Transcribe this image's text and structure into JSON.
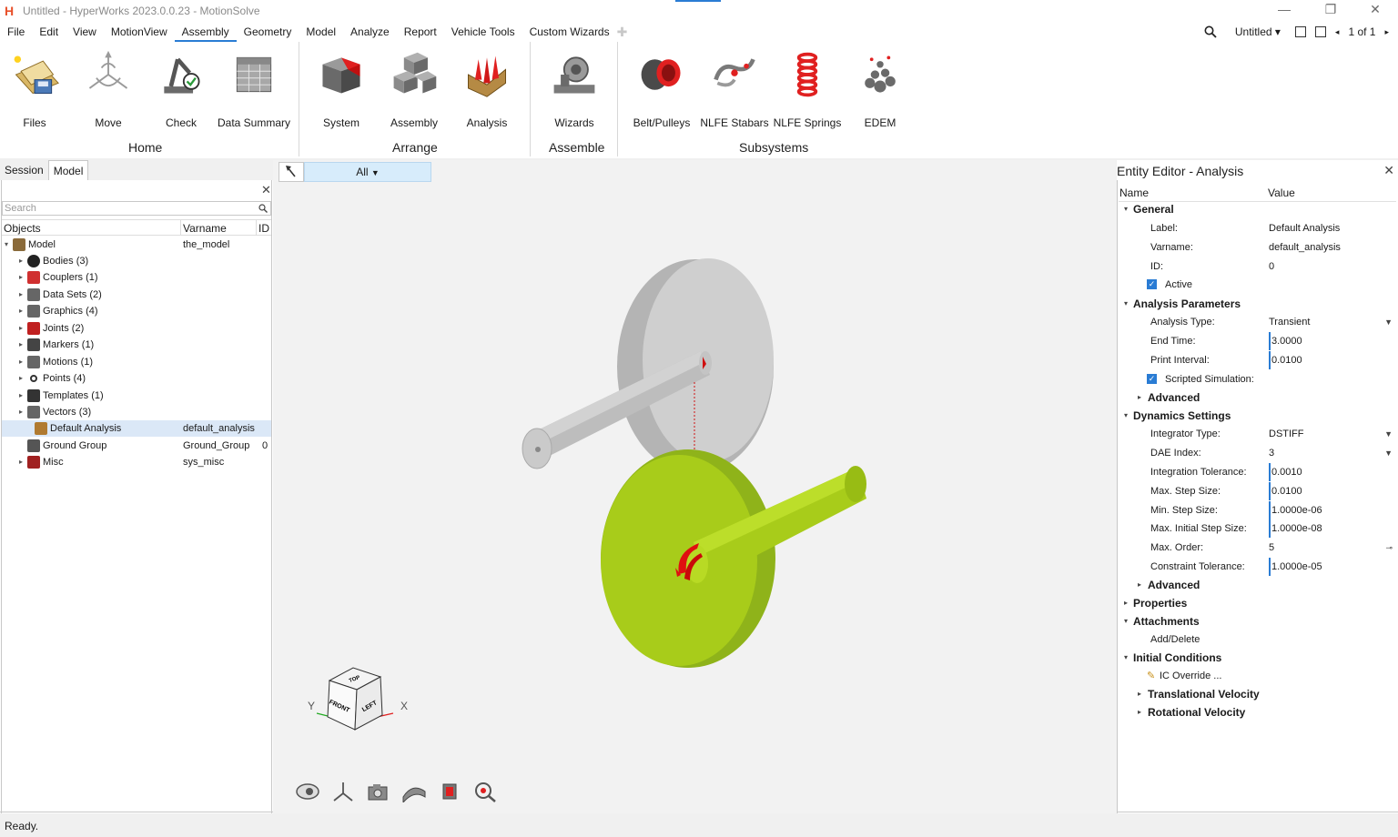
{
  "window": {
    "title": "Untitled - HyperWorks 2023.0.0.23 - MotionSolve",
    "logo": "H"
  },
  "menu": {
    "items": [
      "File",
      "Edit",
      "View",
      "MotionView",
      "Assembly",
      "Geometry",
      "Model",
      "Analyze",
      "Report",
      "Vehicle Tools",
      "Custom Wizards"
    ],
    "active": "Assembly",
    "session_name": "Untitled",
    "page_indicator": "1 of 1"
  },
  "ribbon": {
    "tools": [
      {
        "label": "Files",
        "icon": "files-icon"
      },
      {
        "label": "Move",
        "icon": "move-icon"
      },
      {
        "label": "Check",
        "icon": "check-icon"
      },
      {
        "label": "Data Summary",
        "icon": "data-summary-icon"
      },
      {
        "label": "System",
        "icon": "system-icon"
      },
      {
        "label": "Assembly",
        "icon": "assembly-icon"
      },
      {
        "label": "Analysis",
        "icon": "analysis-icon"
      },
      {
        "label": "Wizards",
        "icon": "wizards-icon"
      },
      {
        "label": "Belt/Pulleys",
        "icon": "belt-pulleys-icon"
      },
      {
        "label": "NLFE Stabars",
        "icon": "nlfe-stabars-icon"
      },
      {
        "label": "NLFE Springs",
        "icon": "nlfe-springs-icon"
      },
      {
        "label": "EDEM",
        "icon": "edem-icon"
      }
    ],
    "groups": [
      "Home",
      "Arrange",
      "Assemble",
      "Subsystems"
    ]
  },
  "browser": {
    "tabs": [
      "Session",
      "Model"
    ],
    "active_tab": "Model",
    "search_placeholder": "Search",
    "columns": [
      "Objects",
      "Varname",
      "ID"
    ],
    "rows": [
      {
        "label": "Model",
        "varname": "the_model",
        "id": "",
        "icon": "model-icon"
      },
      {
        "label": "Bodies (3)",
        "varname": "",
        "id": "",
        "icon": "bodies-icon"
      },
      {
        "label": "Couplers (1)",
        "varname": "",
        "id": "",
        "icon": "couplers-icon"
      },
      {
        "label": "Data Sets (2)",
        "varname": "",
        "id": "",
        "icon": "datasets-icon"
      },
      {
        "label": "Graphics (4)",
        "varname": "",
        "id": "",
        "icon": "graphics-icon"
      },
      {
        "label": "Joints (2)",
        "varname": "",
        "id": "",
        "icon": "joints-icon"
      },
      {
        "label": "Markers (1)",
        "varname": "",
        "id": "",
        "icon": "markers-icon"
      },
      {
        "label": "Motions (1)",
        "varname": "",
        "id": "",
        "icon": "motions-icon"
      },
      {
        "label": "Points (4)",
        "varname": "",
        "id": "",
        "icon": "points-icon"
      },
      {
        "label": "Templates (1)",
        "varname": "",
        "id": "",
        "icon": "templates-icon"
      },
      {
        "label": "Vectors (3)",
        "varname": "",
        "id": "",
        "icon": "vectors-icon"
      },
      {
        "label": "Default Analysis",
        "varname": "default_analysis",
        "id": "",
        "icon": "analysis-icon"
      },
      {
        "label": "Ground Group",
        "varname": "Ground_Group",
        "id": "0",
        "icon": "ground-icon"
      },
      {
        "label": "Misc",
        "varname": "sys_misc",
        "id": "",
        "icon": "misc-icon"
      }
    ]
  },
  "viewport": {
    "filter_label": "All",
    "axis_x": "X",
    "axis_y": "Y",
    "cube_faces": [
      "TOP",
      "FRONT",
      "LEFT"
    ],
    "colors": {
      "upper_disk": "#c8c8c8",
      "lower_disk": "#a8cc1a",
      "joint": "#e01010"
    }
  },
  "entity_editor": {
    "title": "Entity Editor - Analysis",
    "columns": [
      "Name",
      "Value"
    ],
    "rows": [
      {
        "name": "General",
        "value": "",
        "type": "section"
      },
      {
        "name": "Label:",
        "value": "Default Analysis",
        "type": "field"
      },
      {
        "name": "Varname:",
        "value": "default_analysis",
        "type": "field"
      },
      {
        "name": "ID:",
        "value": "0",
        "type": "field"
      },
      {
        "name": "Active",
        "value": "",
        "type": "check"
      },
      {
        "name": "Analysis Parameters",
        "value": "",
        "type": "section"
      },
      {
        "name": "Analysis Type:",
        "value": "Transient",
        "type": "dropdown"
      },
      {
        "name": "End Time:",
        "value": "3.0000",
        "type": "edit"
      },
      {
        "name": "Print Interval:",
        "value": "0.0100",
        "type": "edit"
      },
      {
        "name": "Scripted Simulation:",
        "value": "",
        "type": "check"
      },
      {
        "name": "Advanced",
        "value": "",
        "type": "subsection"
      },
      {
        "name": "Dynamics Settings",
        "value": "",
        "type": "section"
      },
      {
        "name": "Integrator Type:",
        "value": "DSTIFF",
        "type": "dropdown"
      },
      {
        "name": "DAE Index:",
        "value": "3",
        "type": "dropdown"
      },
      {
        "name": "Integration Tolerance:",
        "value": "0.0010",
        "type": "edit"
      },
      {
        "name": "Max. Step Size:",
        "value": "0.0100",
        "type": "edit"
      },
      {
        "name": "Min. Step Size:",
        "value": "1.0000e-06",
        "type": "edit"
      },
      {
        "name": "Max. Initial Step Size:",
        "value": "1.0000e-08",
        "type": "edit"
      },
      {
        "name": "Max. Order:",
        "value": "5",
        "type": "slider"
      },
      {
        "name": "Constraint Tolerance:",
        "value": "1.0000e-05",
        "type": "edit"
      },
      {
        "name": "Advanced",
        "value": "",
        "type": "subsection"
      },
      {
        "name": "Properties",
        "value": "",
        "type": "section-collapsed"
      },
      {
        "name": "Attachments",
        "value": "",
        "type": "section"
      },
      {
        "name": "Add/Delete",
        "value": "",
        "type": "field"
      },
      {
        "name": "Initial Conditions",
        "value": "",
        "type": "section"
      },
      {
        "name": "IC Override ...",
        "value": "",
        "type": "field"
      },
      {
        "name": "Translational Velocity",
        "value": "",
        "type": "subsection"
      },
      {
        "name": "Rotational Velocity",
        "value": "",
        "type": "subsection"
      }
    ]
  },
  "status": {
    "text": "Ready."
  }
}
